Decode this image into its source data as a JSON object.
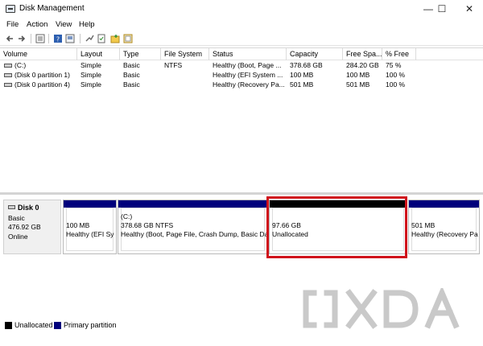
{
  "window": {
    "title": "Disk Management",
    "controls": {
      "minimize": "—",
      "maximize": "☐",
      "close": "✕"
    }
  },
  "menu": [
    "File",
    "Action",
    "View",
    "Help"
  ],
  "toolbar": {
    "icons": [
      "back-arrow-icon",
      "forward-arrow-icon",
      "list-view-icon",
      "help-icon",
      "properties-icon",
      "connect-icon",
      "refresh-icon",
      "folder-icon",
      "settings-icon"
    ]
  },
  "volumes": {
    "columns": [
      "Volume",
      "Layout",
      "Type",
      "File System",
      "Status",
      "Capacity",
      "Free Spa...",
      "% Free"
    ],
    "rows": [
      [
        "(C:)",
        "Simple",
        "Basic",
        "NTFS",
        "Healthy (Boot, Page ...",
        "378.68 GB",
        "284.20 GB",
        "75 %"
      ],
      [
        "(Disk 0 partition 1)",
        "Simple",
        "Basic",
        "",
        "Healthy (EFI System ...",
        "100 MB",
        "100 MB",
        "100 %"
      ],
      [
        "(Disk 0 partition 4)",
        "Simple",
        "Basic",
        "",
        "Healthy (Recovery Pa...",
        "501 MB",
        "501 MB",
        "100 %"
      ]
    ]
  },
  "disk": {
    "name": "Disk 0",
    "type": "Basic",
    "size": "476.92 GB",
    "status": "Online",
    "partitions": [
      {
        "kind": "primary",
        "line1": "",
        "line2": "100 MB",
        "line3": "Healthy (EFI Sy"
      },
      {
        "kind": "primary",
        "line1": "(C:)",
        "line2": "378.68 GB NTFS",
        "line3": "Healthy (Boot, Page File, Crash Dump, Basic Da"
      },
      {
        "kind": "unallocated",
        "line1": "",
        "line2": "97.66 GB",
        "line3": "Unallocated"
      },
      {
        "kind": "primary",
        "line1": "",
        "line2": "501 MB",
        "line3": "Healthy (Recovery Pa"
      }
    ]
  },
  "legend": [
    {
      "label": "Unallocated",
      "color": "#000000"
    },
    {
      "label": "Primary partition",
      "color": "#00007c"
    }
  ],
  "colors": {
    "primary": "#00007c",
    "unallocated": "#000000",
    "highlight": "#d0111b"
  },
  "watermark": "XDA"
}
